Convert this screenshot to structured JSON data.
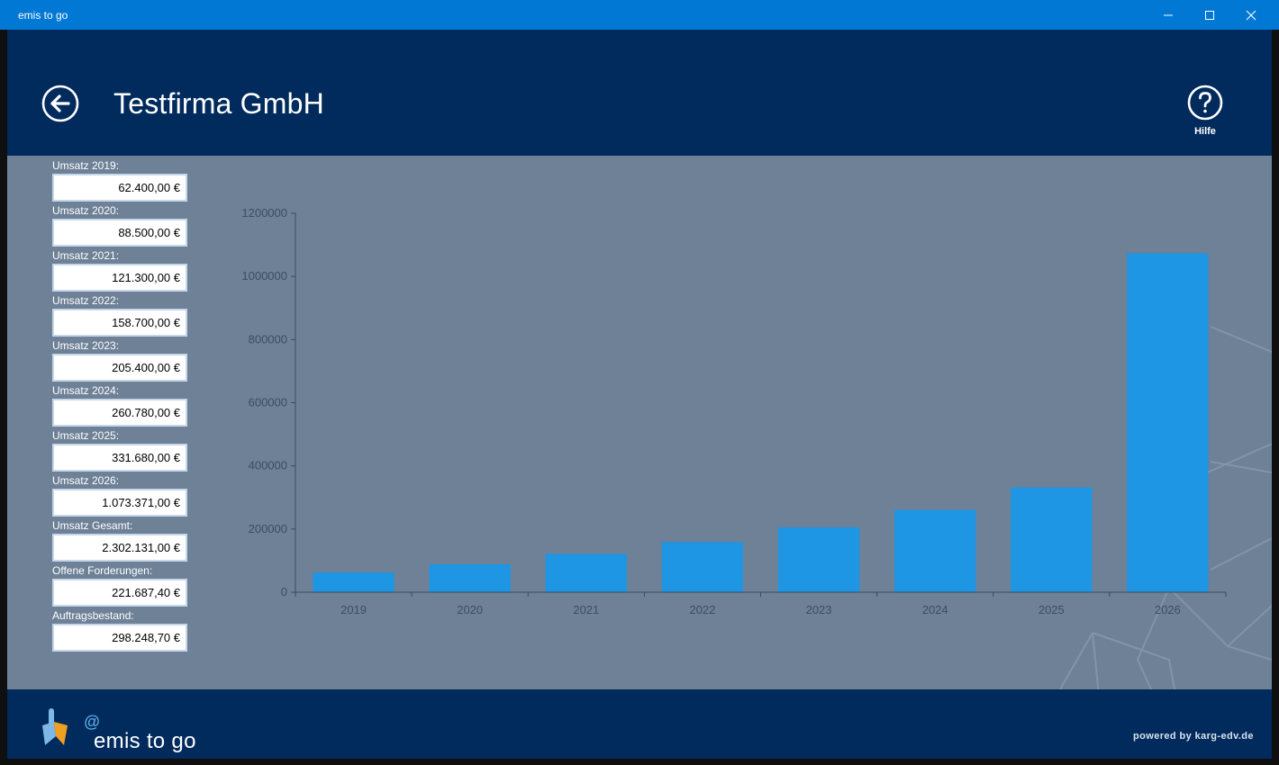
{
  "window": {
    "title": "emis to go"
  },
  "header": {
    "title": "Testfirma GmbH",
    "help_label": "Hilfe"
  },
  "fields": [
    {
      "label": "Umsatz 2019:",
      "value": "62.400,00 €"
    },
    {
      "label": "Umsatz 2020:",
      "value": "88.500,00 €"
    },
    {
      "label": "Umsatz 2021:",
      "value": "121.300,00 €"
    },
    {
      "label": "Umsatz 2022:",
      "value": "158.700,00 €"
    },
    {
      "label": "Umsatz 2023:",
      "value": "205.400,00 €"
    },
    {
      "label": "Umsatz 2024:",
      "value": "260.780,00 €"
    },
    {
      "label": "Umsatz 2025:",
      "value": "331.680,00 €"
    },
    {
      "label": "Umsatz 2026:",
      "value": "1.073.371,00 €"
    },
    {
      "label": "Umsatz Gesamt:",
      "value": "2.302.131,00 €"
    },
    {
      "label": "Offene Forderungen:",
      "value": "221.687,40 €"
    },
    {
      "label": "Auftragsbestand:",
      "value": "298.248,70 €"
    }
  ],
  "chart_data": {
    "type": "bar",
    "categories": [
      "2019",
      "2020",
      "2021",
      "2022",
      "2023",
      "2024",
      "2025",
      "2026"
    ],
    "values": [
      62400,
      88500,
      121300,
      158700,
      205400,
      260780,
      331680,
      1073371
    ],
    "ylim": [
      0,
      1200000
    ],
    "yticks": [
      0,
      200000,
      400000,
      600000,
      800000,
      1000000,
      1200000
    ],
    "ytick_labels": [
      "0",
      "200000",
      "400000",
      "600000",
      "800000",
      "1000000",
      "1200000"
    ],
    "grid": false,
    "bar_color": "#1f96e3",
    "axis_color": "#3a4a5e"
  },
  "footer": {
    "logo_text": "emis to go",
    "powered": "powered by karg-edv.de"
  },
  "colors": {
    "titlebar": "#0078d4",
    "header": "#002b5c",
    "body": "#6e8197"
  }
}
